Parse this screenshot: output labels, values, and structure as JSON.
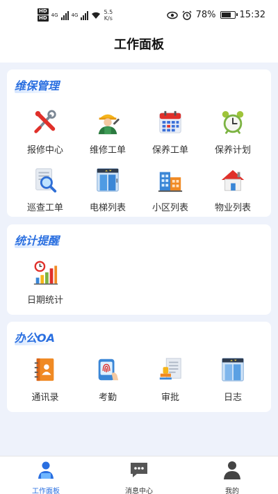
{
  "status_bar": {
    "hd1": "HD",
    "hd2": "HD",
    "net1": "4G",
    "net2": "4G",
    "speed_value": "5.5",
    "speed_unit": "K/s",
    "battery": "78%",
    "battery_level": 0.78,
    "time": "15:32"
  },
  "header": {
    "title": "工作面板"
  },
  "sections": [
    {
      "title": "维保管理",
      "items": [
        {
          "label": "报修中心",
          "icon": "repair-tools-icon"
        },
        {
          "label": "维修工单",
          "icon": "repair-worker-icon"
        },
        {
          "label": "保养工单",
          "icon": "calendar-icon"
        },
        {
          "label": "保养计划",
          "icon": "alarm-clock-icon"
        },
        {
          "label": "巡查工单",
          "icon": "magnifier-document-icon"
        },
        {
          "label": "电梯列表",
          "icon": "elevator-icon"
        },
        {
          "label": "小区列表",
          "icon": "buildings-icon"
        },
        {
          "label": "物业列表",
          "icon": "house-icon"
        }
      ]
    },
    {
      "title": "统计提醒",
      "items": [
        {
          "label": "日期统计",
          "icon": "bar-chart-clock-icon"
        }
      ]
    },
    {
      "title": "办公OA",
      "items": [
        {
          "label": "通讯录",
          "icon": "contact-book-icon"
        },
        {
          "label": "考勤",
          "icon": "fingerprint-icon"
        },
        {
          "label": "审批",
          "icon": "approval-stamp-icon"
        },
        {
          "label": "日志",
          "icon": "log-document-icon"
        }
      ]
    }
  ],
  "tabbar": {
    "tabs": [
      {
        "label": "工作面板",
        "icon": "workspace-person-icon",
        "active": true
      },
      {
        "label": "消息中心",
        "icon": "message-bubble-icon",
        "active": false
      },
      {
        "label": "我的",
        "icon": "user-profile-icon",
        "active": false
      }
    ]
  },
  "colors": {
    "accent": "#2a6fe0",
    "background": "#eef2fb"
  }
}
